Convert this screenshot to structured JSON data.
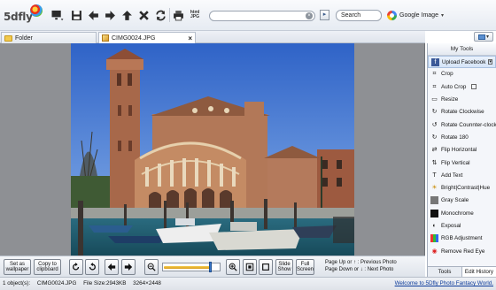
{
  "app": {
    "logo_text": "5dfly"
  },
  "toolbar": {
    "address_value": "",
    "search_label": "Search",
    "engine_label": "Google Image"
  },
  "tabs": [
    {
      "label": "Folder",
      "icon": "folder-icon"
    },
    {
      "label": "CIMG0024.JPG",
      "icon": "jpg-icon"
    }
  ],
  "controls": {
    "wallpaper_label": "Set as wallpaper",
    "clipboard_label": "Copy to clipboard",
    "slideshow_label": "Slide Show",
    "fullscreen_label": "Full Screen",
    "zoom_level": 0.82,
    "hint_prev": "Page Up or ↑ : Previous Photo",
    "hint_next": "Page Down or ↓ : Next Photo"
  },
  "panel": {
    "title": "My Tools",
    "tools": [
      {
        "label": "Upload Facebook",
        "icon": "facebook-icon",
        "active": true
      },
      {
        "label": "Crop",
        "icon": "crop-icon"
      },
      {
        "label": "Auto Crop",
        "icon": "auto-crop-icon"
      },
      {
        "label": "Resize",
        "icon": "resize-icon"
      },
      {
        "label": "Rotate Clockwise",
        "icon": "rotate-cw-icon"
      },
      {
        "label": "Rotate Counnter-clockwise",
        "icon": "rotate-ccw-icon"
      },
      {
        "label": "Rotate 180",
        "icon": "rotate-180-icon"
      },
      {
        "label": "Flip Horizontal",
        "icon": "flip-horizontal-icon"
      },
      {
        "label": "Flip Vertical",
        "icon": "flip-vertical-icon"
      },
      {
        "label": "Add Text",
        "icon": "text-icon"
      },
      {
        "label": "Bright|Contrast|Hue",
        "icon": "brightness-icon"
      },
      {
        "label": "Gray Scale",
        "icon": "grayscale-icon"
      },
      {
        "label": "Monochrome",
        "icon": "monochrome-icon"
      },
      {
        "label": "Exposal",
        "icon": "exposure-icon"
      },
      {
        "label": "RGB Adjustment",
        "icon": "rgb-icon"
      },
      {
        "label": "Remove Red Eye",
        "icon": "red-eye-icon"
      }
    ],
    "tab_tools": "Tools",
    "tab_history": "Edit History"
  },
  "status": {
    "objects": "1 object(s):",
    "filename": "CIMG0024.JPG",
    "filesize": "File Size:2943KB",
    "dimensions": "3264×2448",
    "welcome": "Welcome to 5Dfly Photo Fantacy World."
  }
}
